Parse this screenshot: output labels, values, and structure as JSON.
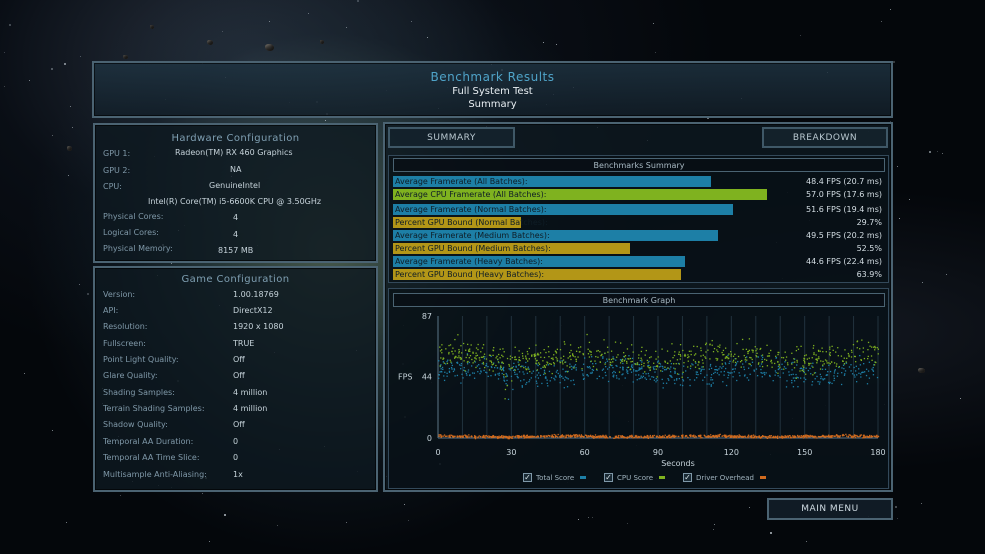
{
  "debug_overlay": [
    "",
    "",
    "",
    ""
  ],
  "header": {
    "title": "Benchmark Results",
    "subtitle": "Full System Test",
    "view": "Summary"
  },
  "hardware": {
    "title": "Hardware Configuration",
    "rows": [
      {
        "label": "GPU 1:",
        "value": "Radeon(TM) RX 460 Graphics"
      },
      {
        "label": "GPU 2:",
        "value": "NA"
      },
      {
        "label": "CPU:",
        "value": "GenuineIntel"
      },
      {
        "label": "",
        "value": "Intel(R) Core(TM) i5-6600K CPU @ 3.50GHz"
      },
      {
        "label": "Physical Cores:",
        "value": "4"
      },
      {
        "label": "Logical Cores:",
        "value": "4"
      },
      {
        "label": "Physical Memory:",
        "value": "8157 MB"
      }
    ]
  },
  "game": {
    "title": "Game Configuration",
    "rows": [
      {
        "label": "Version:",
        "value": "1.00.18769"
      },
      {
        "label": "API:",
        "value": "DirectX12"
      },
      {
        "label": "Resolution:",
        "value": "1920 x 1080"
      },
      {
        "label": "Fullscreen:",
        "value": "TRUE"
      },
      {
        "label": "Point Light Quality:",
        "value": "Off"
      },
      {
        "label": "Glare Quality:",
        "value": "Off"
      },
      {
        "label": "Shading Samples:",
        "value": "4 million"
      },
      {
        "label": "Terrain Shading Samples:",
        "value": "4 million"
      },
      {
        "label": "Shadow Quality:",
        "value": "Off"
      },
      {
        "label": "Temporal AA Duration:",
        "value": "0"
      },
      {
        "label": "Temporal AA Time Slice:",
        "value": "0"
      },
      {
        "label": "Multisample Anti-Aliasing:",
        "value": "1x"
      }
    ]
  },
  "tabs": {
    "summary": "SUMMARY",
    "breakdown": "BREAKDOWN"
  },
  "benchmarks_summary": {
    "title": "Benchmarks Summary",
    "rows": [
      {
        "label": "Average Framerate (All Batches):",
        "value": "48.4 FPS (20.7 ms)",
        "fraction": 0.74,
        "color": "#1d7fa6"
      },
      {
        "label": "Average CPU Framerate (All Batches):",
        "value": "57.0 FPS (17.6 ms)",
        "fraction": 0.87,
        "color": "#7fb21f"
      },
      {
        "label": "Average Framerate (Normal Batches):",
        "value": "51.6 FPS (19.4 ms)",
        "fraction": 0.79,
        "color": "#1d7fa6"
      },
      {
        "label": "Percent GPU Bound (Normal Batches):",
        "value": "29.7%",
        "fraction": 0.297,
        "color": "#b39617"
      },
      {
        "label": "Average Framerate (Medium Batches):",
        "value": "49.5 FPS (20.2 ms)",
        "fraction": 0.755,
        "color": "#1d7fa6"
      },
      {
        "label": "Percent GPU Bound (Medium Batches):",
        "value": "52.5%",
        "fraction": 0.55,
        "color": "#b39617"
      },
      {
        "label": "Average Framerate (Heavy Batches):",
        "value": "44.6 FPS (22.4 ms)",
        "fraction": 0.68,
        "color": "#1d7fa6"
      },
      {
        "label": "Percent GPU Bound (Heavy Batches):",
        "value": "63.9%",
        "fraction": 0.67,
        "color": "#b39617"
      }
    ]
  },
  "chart_data": {
    "type": "scatter",
    "title": "Benchmark Graph",
    "xlabel": "Seconds",
    "ylabel": "FPS",
    "xlim": [
      0,
      180
    ],
    "ylim": [
      0,
      87
    ],
    "xticks": [
      "0",
      "30",
      "60",
      "90",
      "120",
      "150",
      "180"
    ],
    "yticks": [
      "87",
      "44",
      "0"
    ],
    "legend_placement": "bottom",
    "series": [
      {
        "name": "Total Score",
        "color": "#1d7fa6",
        "approx_mean": 48,
        "approx_spread": 9
      },
      {
        "name": "CPU Score",
        "color": "#7fb21f",
        "approx_mean": 58,
        "approx_spread": 10
      },
      {
        "name": "Driver Overhead",
        "color": "#d06a1e",
        "approx_mean": 1.5,
        "approx_spread": 1
      }
    ]
  },
  "main_menu": "MAIN MENU"
}
